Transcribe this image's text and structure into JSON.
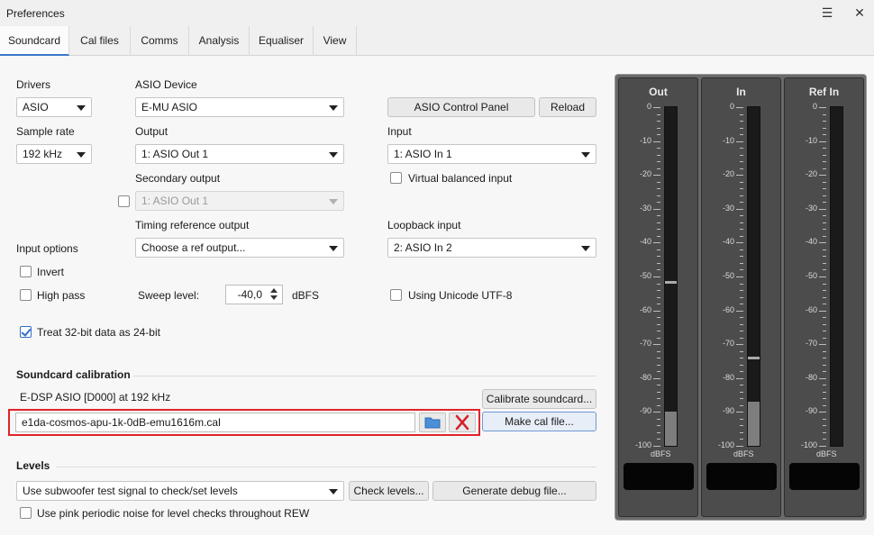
{
  "window": {
    "title": "Preferences",
    "menu_glyph": "☰",
    "close_glyph": "✕"
  },
  "tabs": [
    {
      "label": "Soundcard"
    },
    {
      "label": "Cal files"
    },
    {
      "label": "Comms"
    },
    {
      "label": "Analysis"
    },
    {
      "label": "Equaliser"
    },
    {
      "label": "View"
    }
  ],
  "drivers": {
    "label": "Drivers",
    "value": "ASIO"
  },
  "asio_device": {
    "label": "ASIO Device",
    "value": "E-MU ASIO"
  },
  "asio_control_panel": "ASIO Control Panel",
  "reload": "Reload",
  "sample_rate": {
    "label": "Sample rate",
    "value": "192 kHz"
  },
  "output": {
    "label": "Output",
    "value": "1: ASIO Out 1"
  },
  "input": {
    "label": "Input",
    "value": "1: ASIO In 1"
  },
  "secondary_output": {
    "label": "Secondary output",
    "value": "1: ASIO Out 1",
    "enabled": false
  },
  "virtual_balanced_input": {
    "label": "Virtual balanced input",
    "checked": false
  },
  "timing_reference_output": {
    "label": "Timing reference output",
    "value": "Choose a ref output..."
  },
  "loopback_input": {
    "label": "Loopback input",
    "value": "2: ASIO In 2"
  },
  "input_options": {
    "label": "Input options",
    "invert": {
      "label": "Invert",
      "checked": false
    },
    "high_pass": {
      "label": "High pass",
      "checked": false
    }
  },
  "sweep_level": {
    "label": "Sweep level:",
    "value": "-40,0",
    "unit": "dBFS"
  },
  "unicode_utf8": {
    "label": "Using Unicode UTF-8",
    "checked": false
  },
  "treat_32bit": {
    "label": "Treat 32-bit data as 24-bit",
    "checked": true
  },
  "soundcard_calibration": {
    "title": "Soundcard calibration",
    "device_info": "E-DSP ASIO [D000] at 192 kHz",
    "cal_file": "e1da-cosmos-apu-1k-0dB-emu1616m.cal",
    "calibrate_button": "Calibrate soundcard...",
    "make_cal_button": "Make cal file..."
  },
  "levels": {
    "title": "Levels",
    "mode": "Use subwoofer test signal to check/set levels",
    "check_levels_button": "Check levels...",
    "debug_button": "Generate debug file...",
    "pink_noise": {
      "label": "Use pink periodic noise for level checks throughout REW",
      "checked": false
    }
  },
  "meters": {
    "ticks": [
      "0",
      "-10",
      "-20",
      "-30",
      "-40",
      "-50",
      "-60",
      "-70",
      "-80",
      "-90",
      "-100"
    ],
    "unit": "dBFS",
    "channels": [
      {
        "name": "Out",
        "level_db": -90,
        "peak_db": -51.5
      },
      {
        "name": "In",
        "level_db": -87,
        "peak_db": -74
      },
      {
        "name": "Ref In",
        "level_db": null,
        "peak_db": null
      }
    ]
  },
  "colors": {
    "accent": "#2f6fc4",
    "highlight": "#e0232a",
    "meter_bg": "#4c4c4c"
  }
}
